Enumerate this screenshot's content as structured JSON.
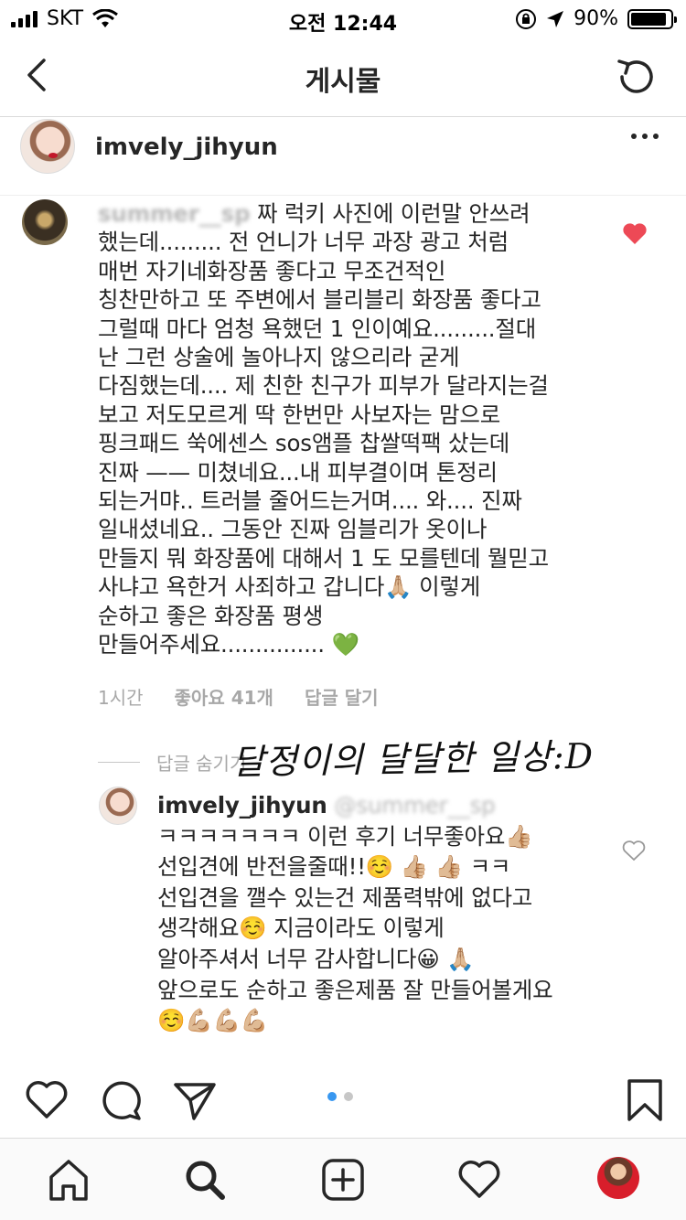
{
  "status_bar": {
    "carrier": "SKT",
    "time": "오전 12:44",
    "battery_percent": "90%",
    "battery_level": 0.9
  },
  "nav": {
    "title": "게시물",
    "back_icon": "chevron-left-icon",
    "refresh_icon": "refresh-icon"
  },
  "post": {
    "username": "imvely_jihyun"
  },
  "comment": {
    "username_blurred": "summer__sp",
    "lines": [
      "짜 럭키 사진에 이런말 안쓰려",
      "했는데......... 전 언니가 너무 과장 광고 처럼",
      "매번 자기네화장품 좋다고 무조건적인",
      "칭찬만하고 또 주변에서 블리블리 화장품 좋다고",
      "그럴때 마다 엄청 욕했던 1 인이예요.........절대",
      "난 그런 상술에 놀아나지 않으리라 굳게",
      "다짐했는데.... 제 친한 친구가 피부가 달라지는걸",
      "보고 저도모르게 딱 한번만 사보자는 맘으로",
      "핑크패드 쑥에센스 sos앰플 찹쌀떡팩 샀는데",
      "진짜 —— 미쳤네요...내 피부결이며 톤정리",
      "되는거먀.. 트러블 줄어드는거며.... 와.... 진짜",
      "일내셨네요.. 그동안 진짜 임블리가 옷이나",
      "만들지 뭐 화장품에 대해서 1 도 모를텐데 뭘믿고",
      "사냐고 욕한거 사죄하고 갑니다🙏🏼 이렇게",
      "순하고 좋은 화장품 평생",
      "만들어주세요............... 💚"
    ],
    "time": "1시간",
    "likes": "좋아요 41개",
    "reply_action": "답글 달기",
    "hide_replies": "답글 숨기기"
  },
  "overlay_text": "달정이의 달달한 일상:D",
  "reply": {
    "username": "imvely_jihyun",
    "mention_blurred": "@summer__sp",
    "lines": [
      "ㅋㅋㅋㅋㅋㅋㅋ 이런 후기 너무좋아요👍🏼",
      "선입견에 반전을줄때!!☺️ 👍🏼 👍🏼 ㅋㅋ",
      "선입견을 깰수 있는건 제품력밖에 없다고",
      "생각해요☺️ 지금이라도 이렇게",
      "알아주셔서 너무 감사합니다😀 🙏🏼",
      "앞으로도 순하고 좋은제품 잘 만들어볼게요",
      "☺️💪🏼💪🏼💪🏼"
    ]
  },
  "actions": {
    "like_icon": "heart-icon",
    "comment_icon": "comment-icon",
    "share_icon": "send-icon",
    "save_icon": "bookmark-icon",
    "carousel_pages": 2,
    "carousel_active": 1
  },
  "tabs": [
    "home-icon",
    "search-icon",
    "add-post-icon",
    "activity-heart-icon",
    "profile-avatar"
  ],
  "colors": {
    "liked_heart": "#ed4956",
    "carousel_active": "#3897f0",
    "carousel_inactive": "#c7c7c7",
    "meta_text": "#a8a8a8"
  }
}
